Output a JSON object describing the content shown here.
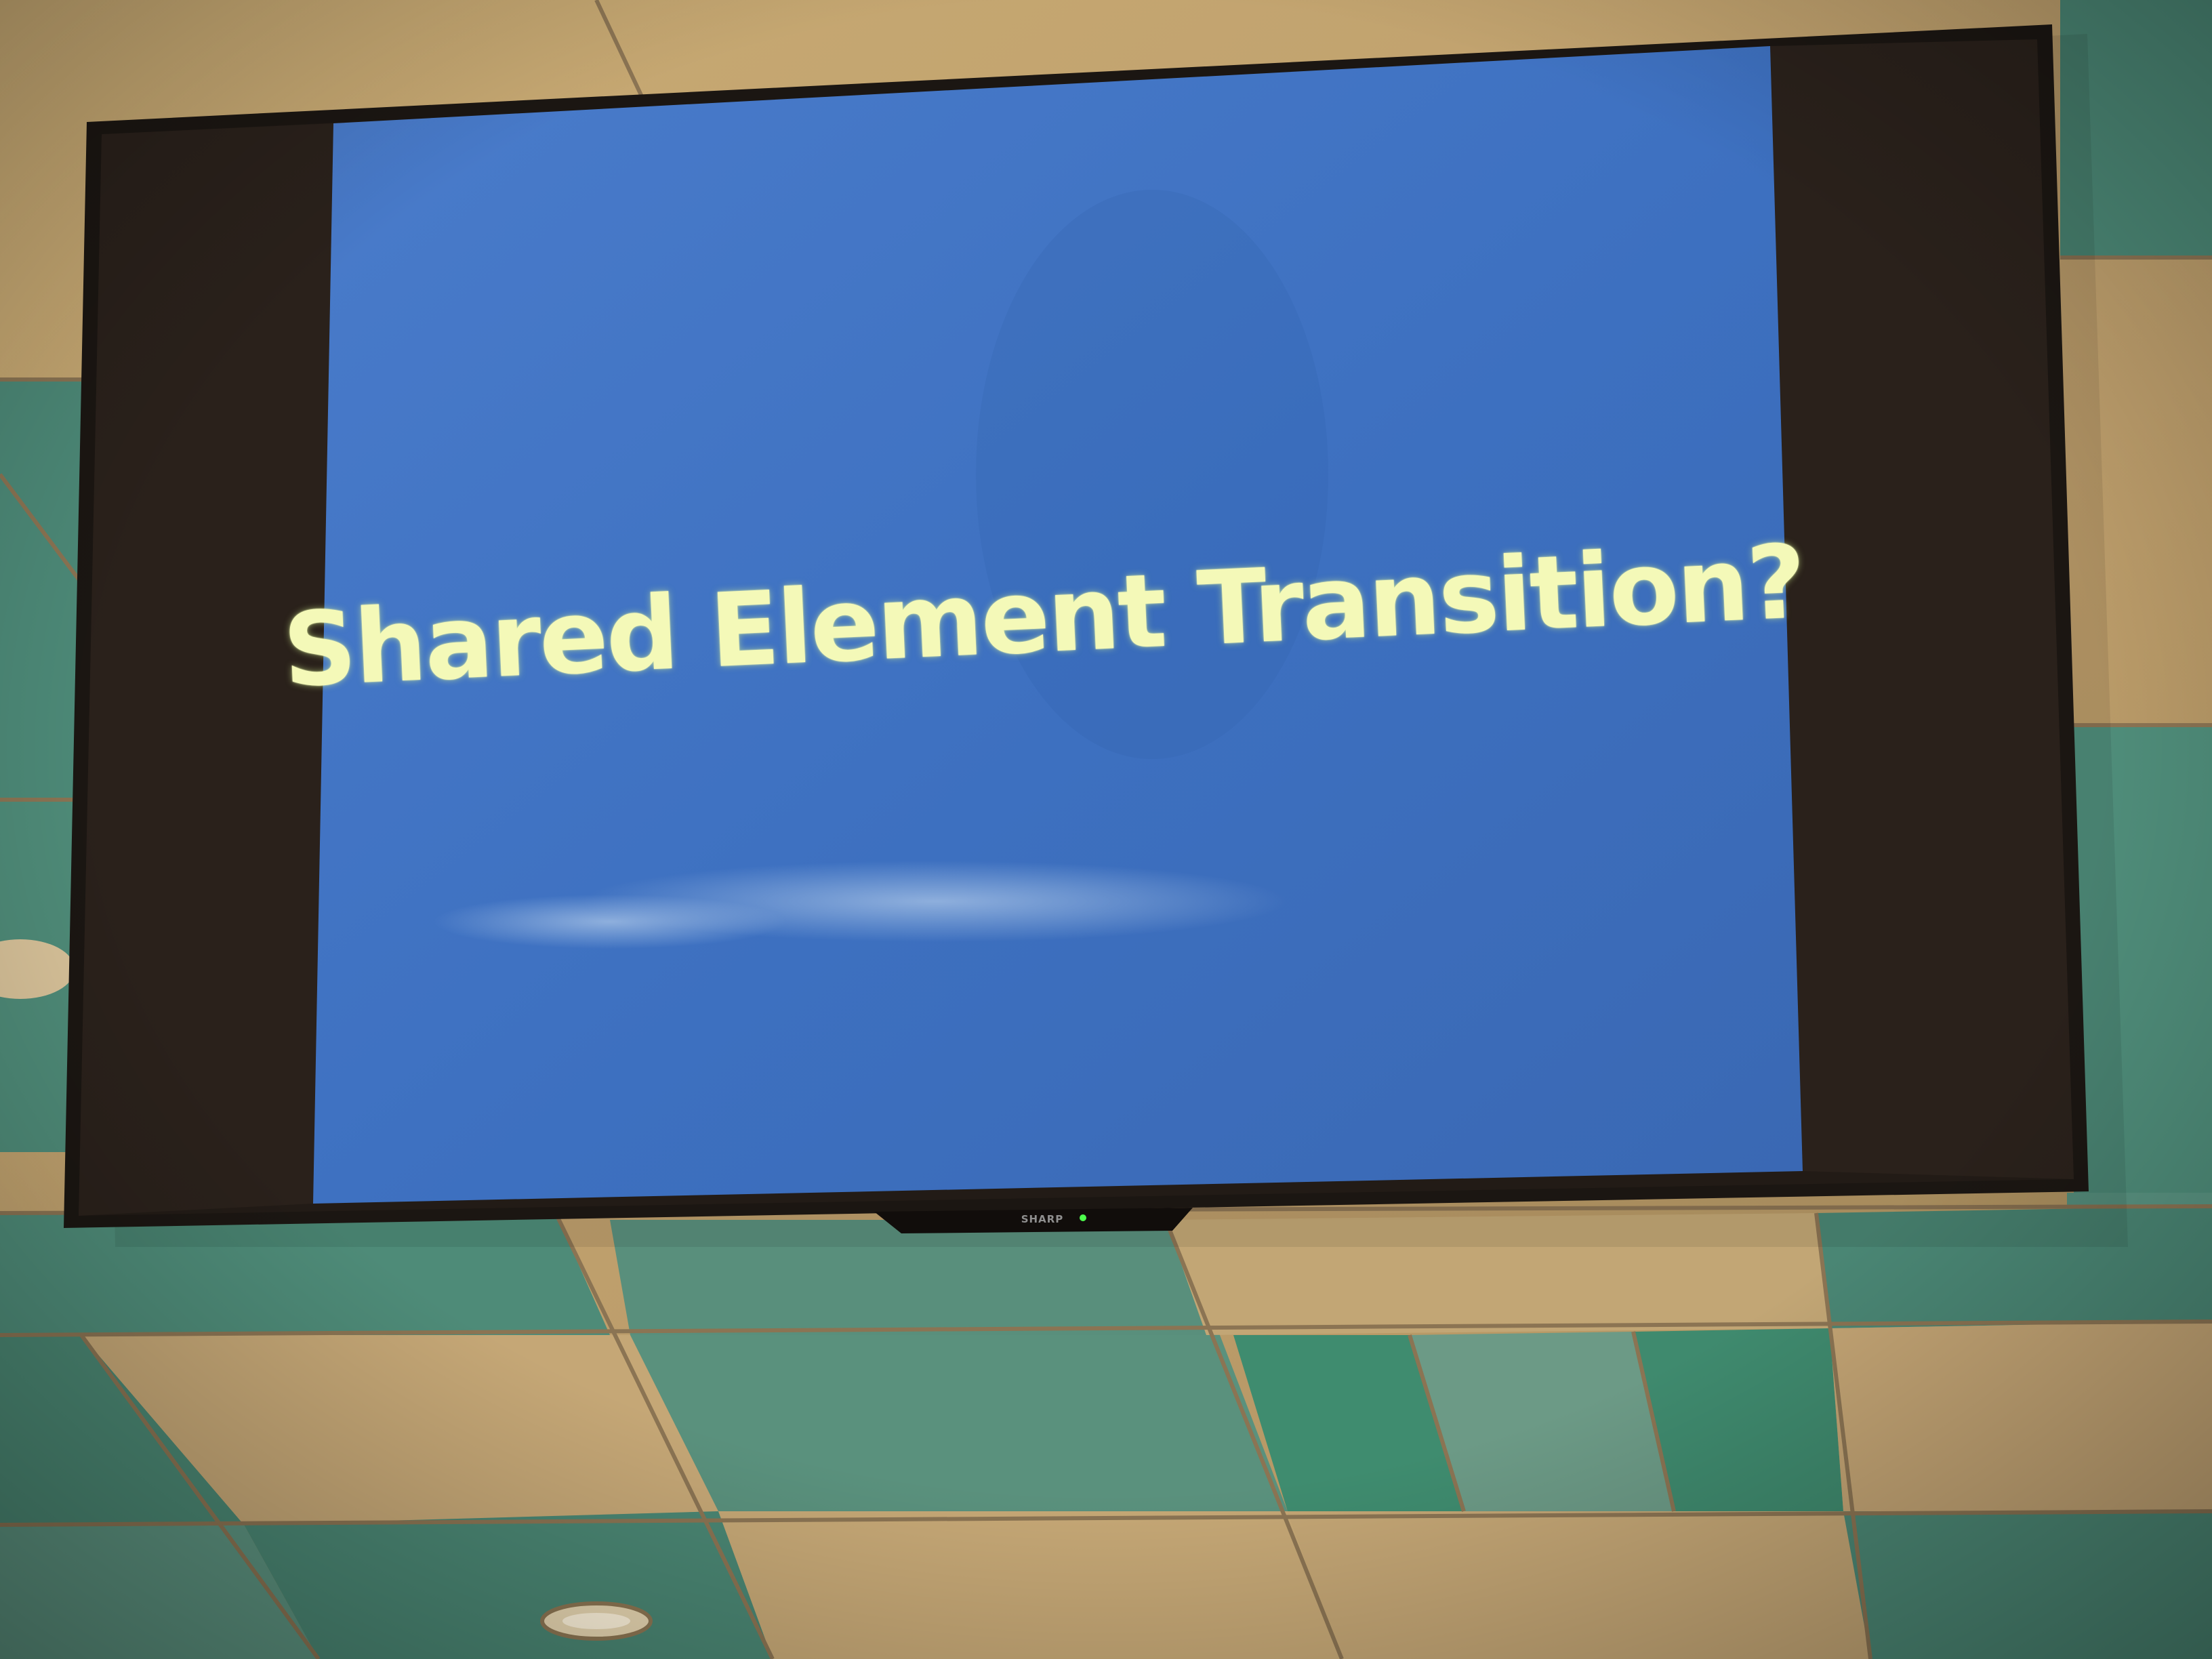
{
  "slide": {
    "title": "Shared Element Transition?"
  },
  "tv": {
    "brand": "SHARP"
  },
  "colors": {
    "slide_blue": "#3f72c2",
    "title_text": "#f4f9b8",
    "bezel": "#1b1612",
    "letterbox": "#2b221c",
    "ceiling_beige": "#c4a674",
    "ceiling_green": "#4f8d7a",
    "power_led": "#4dff4d"
  }
}
